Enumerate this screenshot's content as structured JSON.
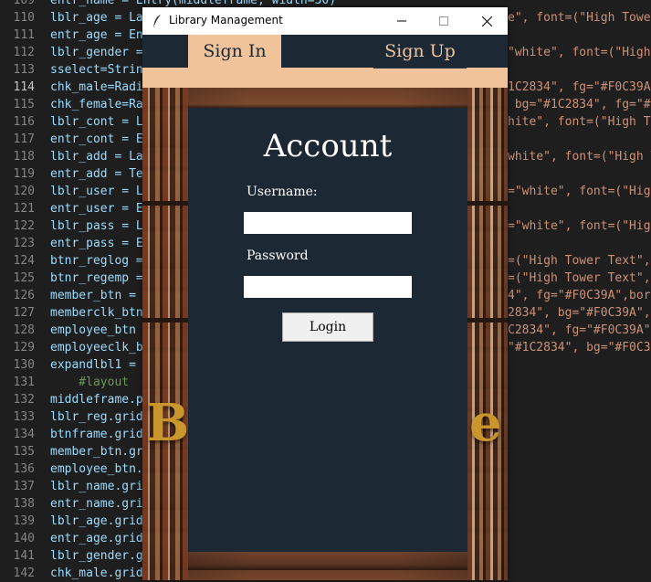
{
  "editor": {
    "line_numbers": [
      "109",
      "110",
      "111",
      "112",
      "113",
      "114",
      "115",
      "116",
      "117",
      "118",
      "119",
      "120",
      "121",
      "122",
      "123",
      "124",
      "125",
      "126",
      "127",
      "128",
      "129",
      "130",
      "131",
      "132",
      "133",
      "134",
      "135",
      "136",
      "137",
      "138",
      "139",
      "140",
      "141",
      "142"
    ],
    "active_line": "114",
    "code_lines": [
      "entr_name = Entry(middleframe, width=30)",
      "lblr_age = La",
      "entr_age = En",
      "lblr_gender =",
      "sselect=Strin",
      "chk_male=Radi",
      "chk_female=Ra",
      "lblr_cont = L",
      "entr_cont = E",
      "lblr_add = La",
      "entr_add = Te",
      "lblr_user = L",
      "entr_user = E",
      "lblr_pass = L",
      "entr_pass = E",
      "btnr_reglog =",
      "btnr_regemp =",
      "member_btn =",
      "memberclk_btn",
      "employee_btn",
      "employeeclk_b",
      "expandlbl1 =",
      "    #layout",
      "middleframe.p",
      "lblr_reg.grid",
      "btnframe.grid",
      "member_btn.gr",
      "employee_btn.",
      "lblr_name.gri",
      "entr_name.gri",
      "lblr_age.grid",
      "entr_age.grid",
      "lblr_gender.g",
      "chk_male.grid"
    ],
    "right_lines": [
      {
        "line": 1,
        "text": "e\", font=(\"High Tower"
      },
      {
        "line": 3,
        "text": "\"white\", font=(\"High"
      },
      {
        "line": 5,
        "text": "1C2834\", fg=\"#F0C39A\""
      },
      {
        "line": 6,
        "text": " bg=\"#1C2834\", fg=\"#F"
      },
      {
        "line": 7,
        "text": "hite\", font=(\"High To"
      },
      {
        "line": 9,
        "text": "white\", font=(\"High T"
      },
      {
        "line": 11,
        "text": "=\"white\", font=(\"High"
      },
      {
        "line": 13,
        "text": "=\"white\", font=(\"High"
      },
      {
        "line": 15,
        "text": "=(\"High Tower Text\","
      },
      {
        "line": 16,
        "text": "=(\"High Tower Text\","
      },
      {
        "line": 17,
        "text": "4\", fg=\"#F0C39A\",bord"
      },
      {
        "line": 18,
        "text": "2834\", bg=\"#F0C39A\",b"
      },
      {
        "line": 19,
        "text": "C2834\", fg=\"#F0C39A\","
      },
      {
        "line": 20,
        "text": "\"#1C2834\", bg=\"#F0C39"
      }
    ]
  },
  "window": {
    "title": "Library Management",
    "minimize_glyph": "—",
    "maximize_glyph": "☐",
    "close_glyph": "✕"
  },
  "nav": {
    "sign_in": "Sign In",
    "sign_up": "Sign Up"
  },
  "background_text": {
    "left_letter": "B",
    "right_letter": "e"
  },
  "form": {
    "title": "Account",
    "username_label": "Username:",
    "username_value": "",
    "password_label": "Password",
    "password_value": "",
    "login_button": "Login"
  },
  "colors": {
    "navy": "#1C2834",
    "peach": "#F0C39A"
  }
}
